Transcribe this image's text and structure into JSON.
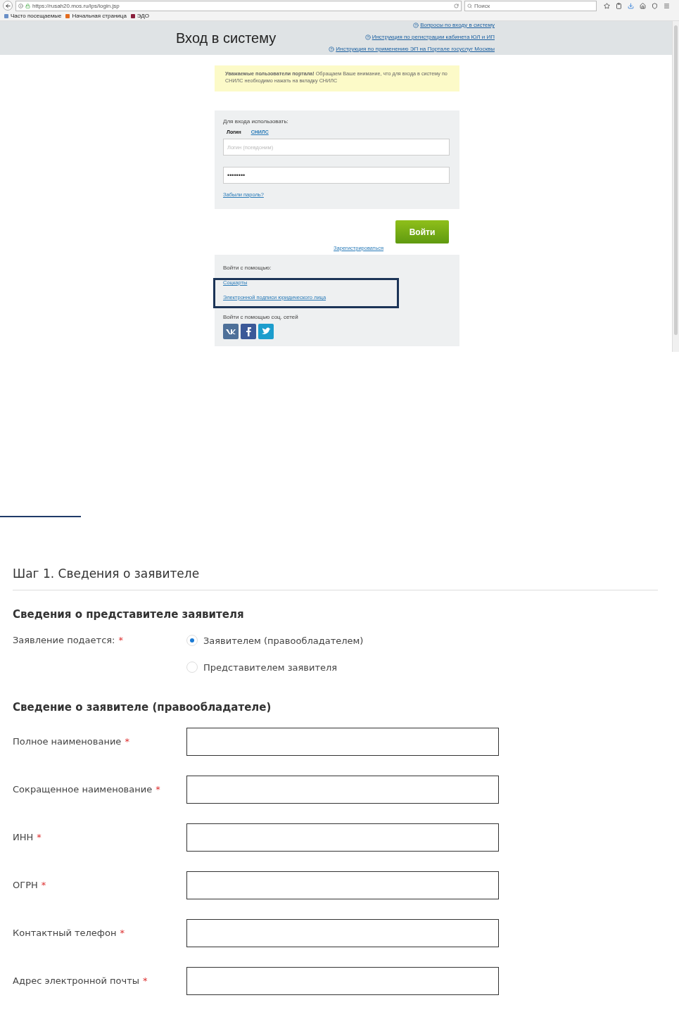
{
  "browser": {
    "url": "https://rusah20.mos.ru/ips/login.jsp",
    "search_placeholder": "Поиск",
    "bookmarks": [
      {
        "label": "Часто посещаемые",
        "color": "#6a8fc7"
      },
      {
        "label": "Начальная страница",
        "color": "#e36b1e"
      },
      {
        "label": "ЭДО",
        "color": "#8a1f3c"
      }
    ]
  },
  "login_page": {
    "title": "Вход в систему",
    "help_links": [
      "Вопросы по входу в систему",
      "Инструкция по регистрации кабинета ЮЛ и ИП",
      "Инструкция по применению ЭП на Портале госуслуг Москвы"
    ],
    "notice": "**Уважаемые пользователи портала!** Обращаем Ваше внимание, что для входа в систему по СНИЛС необходимо нажать на вкладку СНИЛС",
    "login_panel": {
      "caption": "Для входа использовать:",
      "tabs": [
        {
          "label": "Логин",
          "selected": true
        },
        {
          "label": "СНИЛС",
          "selected": false
        }
      ],
      "login_field": {
        "placeholder": "Логин (псевдоним)"
      },
      "password_field": {
        "value": "••••••••"
      },
      "forgot_link": "Забыли пароль?"
    },
    "submit_button": "Войти",
    "register_link": "Зарегистрироваться",
    "alt_login": {
      "caption": "Войти с помощью:",
      "links": [
        "Соцкарты",
        "Электронной подписи юридического лица"
      ],
      "social_caption": "Войти с помощью соц. сетей"
    }
  },
  "form": {
    "step_title": "Шаг 1. Сведения о заявителе",
    "sections": [
      {
        "kind": "radio",
        "heading": "Сведения о представителе заявителя",
        "label": "Заявление подается:",
        "mark": "*",
        "options": [
          {
            "label": "Заявителем (правообладателем)",
            "selected": true
          },
          {
            "label": "Представителем заявителя",
            "selected": false
          }
        ]
      },
      {
        "kind": "fields",
        "heading": "Сведение о заявителе (правообладателе)",
        "fields": [
          {
            "label": "Полное наименование",
            "mark": "*"
          },
          {
            "label": "Сокращенное наименование",
            "mark": "*"
          },
          {
            "label": "ИНН",
            "mark": "*"
          },
          {
            "label": "ОГРН",
            "mark": "*"
          },
          {
            "label": "Контактный телефон",
            "mark": "*"
          },
          {
            "label": "Адрес электронной почты",
            "mark": "*"
          }
        ]
      }
    ]
  }
}
